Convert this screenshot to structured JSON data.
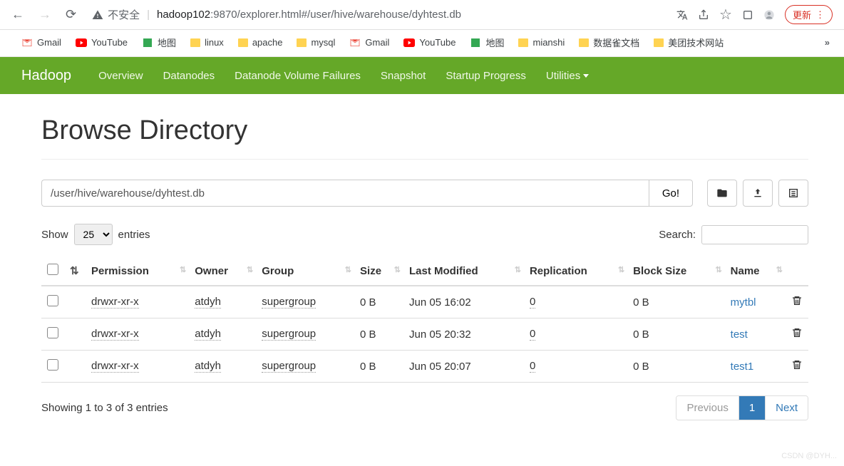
{
  "browser": {
    "insecure_label": "不安全",
    "url_host": "hadoop102",
    "url_port": ":9870",
    "url_path": "/explorer.html#/user/hive/warehouse/dyhtest.db",
    "update_label": "更新"
  },
  "bookmarks": {
    "items": [
      "Gmail",
      "YouTube",
      "地图",
      "linux",
      "apache",
      "mysql",
      "Gmail",
      "YouTube",
      "地图",
      "mianshi",
      "数据雀文档",
      "美团技术网站"
    ]
  },
  "nav": {
    "brand": "Hadoop",
    "items": [
      "Overview",
      "Datanodes",
      "Datanode Volume Failures",
      "Snapshot",
      "Startup Progress",
      "Utilities"
    ]
  },
  "page": {
    "title": "Browse Directory",
    "path_value": "/user/hive/warehouse/dyhtest.db",
    "go_label": "Go!",
    "show_label": "Show",
    "entries_label": "entries",
    "entries_value": "25",
    "search_label": "Search:"
  },
  "table": {
    "headers": [
      "",
      "",
      "Permission",
      "Owner",
      "Group",
      "Size",
      "Last Modified",
      "Replication",
      "Block Size",
      "Name",
      ""
    ],
    "rows": [
      {
        "permission": "drwxr-xr-x",
        "owner": "atdyh",
        "group": "supergroup",
        "size": "0 B",
        "modified": "Jun 05 16:02",
        "replication": "0",
        "block_size": "0 B",
        "name": "mytbl"
      },
      {
        "permission": "drwxr-xr-x",
        "owner": "atdyh",
        "group": "supergroup",
        "size": "0 B",
        "modified": "Jun 05 20:32",
        "replication": "0",
        "block_size": "0 B",
        "name": "test"
      },
      {
        "permission": "drwxr-xr-x",
        "owner": "atdyh",
        "group": "supergroup",
        "size": "0 B",
        "modified": "Jun 05 20:07",
        "replication": "0",
        "block_size": "0 B",
        "name": "test1"
      }
    ]
  },
  "footer": {
    "showing": "Showing 1 to 3 of 3 entries",
    "prev": "Previous",
    "page": "1",
    "next": "Next"
  },
  "watermark": "CSDN @DYH..."
}
